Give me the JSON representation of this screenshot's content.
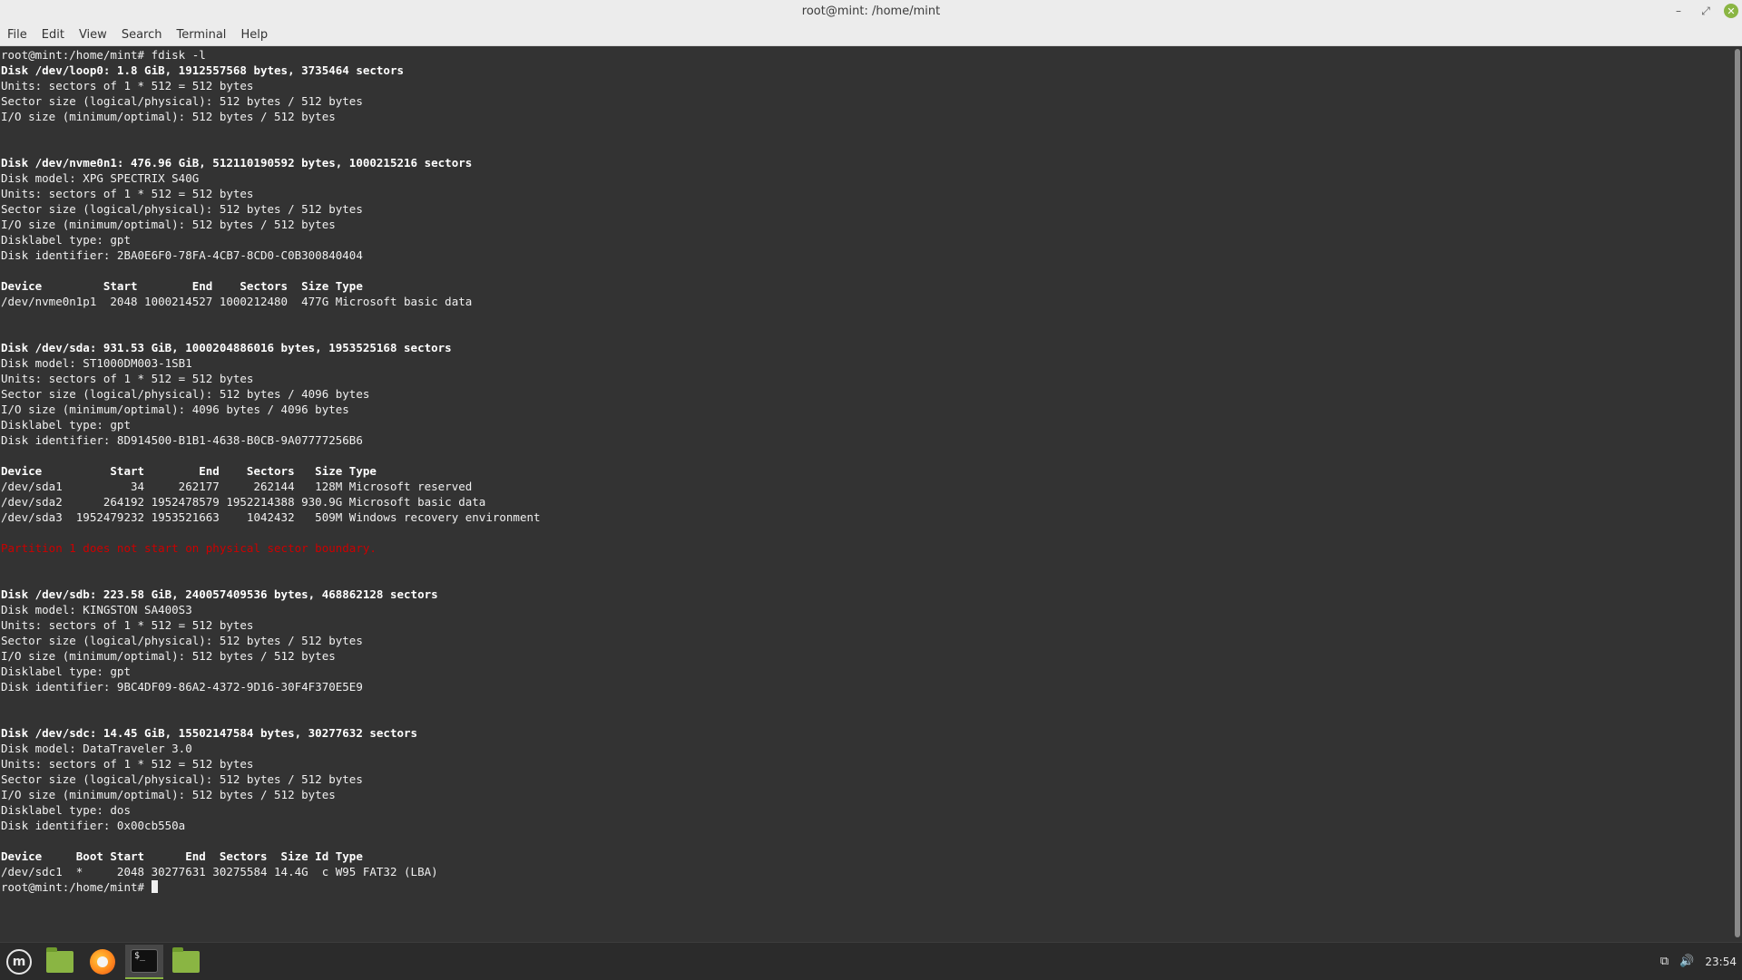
{
  "window": {
    "title": "root@mint: /home/mint",
    "controls": {
      "minimize": "–",
      "maximize": "⤢",
      "close": "✕"
    }
  },
  "menu": {
    "items": [
      "File",
      "Edit",
      "View",
      "Search",
      "Terminal",
      "Help"
    ]
  },
  "terminal": {
    "lines": [
      {
        "text": "root@mint:/home/mint# fdisk -l",
        "style": "normal"
      },
      {
        "text": "Disk /dev/loop0: 1.8 GiB, 1912557568 bytes, 3735464 sectors",
        "style": "bold"
      },
      {
        "text": "Units: sectors of 1 * 512 = 512 bytes",
        "style": "normal"
      },
      {
        "text": "Sector size (logical/physical): 512 bytes / 512 bytes",
        "style": "normal"
      },
      {
        "text": "I/O size (minimum/optimal): 512 bytes / 512 bytes",
        "style": "normal"
      },
      {
        "text": "",
        "style": "normal"
      },
      {
        "text": "",
        "style": "normal"
      },
      {
        "text": "Disk /dev/nvme0n1: 476.96 GiB, 512110190592 bytes, 1000215216 sectors",
        "style": "bold"
      },
      {
        "text": "Disk model: XPG SPECTRIX S40G",
        "style": "normal"
      },
      {
        "text": "Units: sectors of 1 * 512 = 512 bytes",
        "style": "normal"
      },
      {
        "text": "Sector size (logical/physical): 512 bytes / 512 bytes",
        "style": "normal"
      },
      {
        "text": "I/O size (minimum/optimal): 512 bytes / 512 bytes",
        "style": "normal"
      },
      {
        "text": "Disklabel type: gpt",
        "style": "normal"
      },
      {
        "text": "Disk identifier: 2BA0E6F0-78FA-4CB7-8CD0-C0B300840404",
        "style": "normal"
      },
      {
        "text": "",
        "style": "normal"
      },
      {
        "text": "Device         Start        End    Sectors  Size Type",
        "style": "bold"
      },
      {
        "text": "/dev/nvme0n1p1  2048 1000214527 1000212480  477G Microsoft basic data",
        "style": "normal"
      },
      {
        "text": "",
        "style": "normal"
      },
      {
        "text": "",
        "style": "normal"
      },
      {
        "text": "Disk /dev/sda: 931.53 GiB, 1000204886016 bytes, 1953525168 sectors",
        "style": "bold"
      },
      {
        "text": "Disk model: ST1000DM003-1SB1",
        "style": "normal"
      },
      {
        "text": "Units: sectors of 1 * 512 = 512 bytes",
        "style": "normal"
      },
      {
        "text": "Sector size (logical/physical): 512 bytes / 4096 bytes",
        "style": "normal"
      },
      {
        "text": "I/O size (minimum/optimal): 4096 bytes / 4096 bytes",
        "style": "normal"
      },
      {
        "text": "Disklabel type: gpt",
        "style": "normal"
      },
      {
        "text": "Disk identifier: 8D914500-B1B1-4638-B0CB-9A07777256B6",
        "style": "normal"
      },
      {
        "text": "",
        "style": "normal"
      },
      {
        "text": "Device          Start        End    Sectors   Size Type",
        "style": "bold"
      },
      {
        "text": "/dev/sda1          34     262177     262144   128M Microsoft reserved",
        "style": "normal"
      },
      {
        "text": "/dev/sda2      264192 1952478579 1952214388 930.9G Microsoft basic data",
        "style": "normal"
      },
      {
        "text": "/dev/sda3  1952479232 1953521663    1042432   509M Windows recovery environment",
        "style": "normal"
      },
      {
        "text": "",
        "style": "normal"
      },
      {
        "text": "Partition 1 does not start on physical sector boundary.",
        "style": "error"
      },
      {
        "text": "",
        "style": "normal"
      },
      {
        "text": "",
        "style": "normal"
      },
      {
        "text": "Disk /dev/sdb: 223.58 GiB, 240057409536 bytes, 468862128 sectors",
        "style": "bold"
      },
      {
        "text": "Disk model: KINGSTON SA400S3",
        "style": "normal"
      },
      {
        "text": "Units: sectors of 1 * 512 = 512 bytes",
        "style": "normal"
      },
      {
        "text": "Sector size (logical/physical): 512 bytes / 512 bytes",
        "style": "normal"
      },
      {
        "text": "I/O size (minimum/optimal): 512 bytes / 512 bytes",
        "style": "normal"
      },
      {
        "text": "Disklabel type: gpt",
        "style": "normal"
      },
      {
        "text": "Disk identifier: 9BC4DF09-86A2-4372-9D16-30F4F370E5E9",
        "style": "normal"
      },
      {
        "text": "",
        "style": "normal"
      },
      {
        "text": "",
        "style": "normal"
      },
      {
        "text": "Disk /dev/sdc: 14.45 GiB, 15502147584 bytes, 30277632 sectors",
        "style": "bold"
      },
      {
        "text": "Disk model: DataTraveler 3.0",
        "style": "normal"
      },
      {
        "text": "Units: sectors of 1 * 512 = 512 bytes",
        "style": "normal"
      },
      {
        "text": "Sector size (logical/physical): 512 bytes / 512 bytes",
        "style": "normal"
      },
      {
        "text": "I/O size (minimum/optimal): 512 bytes / 512 bytes",
        "style": "normal"
      },
      {
        "text": "Disklabel type: dos",
        "style": "normal"
      },
      {
        "text": "Disk identifier: 0x00cb550a",
        "style": "normal"
      },
      {
        "text": "",
        "style": "normal"
      },
      {
        "text": "Device     Boot Start      End  Sectors  Size Id Type",
        "style": "bold"
      },
      {
        "text": "/dev/sdc1  *     2048 30277631 30275584 14.4G  c W95 FAT32 (LBA)",
        "style": "normal"
      }
    ],
    "prompt": "root@mint:/home/mint# "
  },
  "taskbar": {
    "apps": [
      {
        "name": "menu",
        "icon": "mint-logo-icon",
        "glyph": "m"
      },
      {
        "name": "files",
        "icon": "folder-icon"
      },
      {
        "name": "firefox",
        "icon": "firefox-icon"
      },
      {
        "name": "terminal",
        "icon": "terminal-icon",
        "glyph": "$_",
        "active": true
      },
      {
        "name": "files-2",
        "icon": "folder-icon"
      }
    ],
    "tray": {
      "network_icon": "⧉",
      "volume_icon": "🔊",
      "clock": "23:54"
    }
  },
  "colors": {
    "terminal_bg": "#333333",
    "terminal_fg": "#f0f0f0",
    "error": "#cc0000",
    "accent": "#8ab543",
    "taskbar_bg": "#2b2b2b"
  }
}
